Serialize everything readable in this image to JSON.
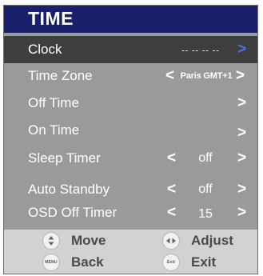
{
  "title": "TIME",
  "rows": [
    {
      "label": "Clock",
      "value": "-- --   -- --",
      "arrow_right": ">"
    },
    {
      "label": "Time Zone",
      "arrow_left": "<",
      "value": "Paris GMT+1",
      "arrow_right": ">"
    },
    {
      "label": "Off Time",
      "arrow_right": ">"
    },
    {
      "label": "On Time",
      "arrow_right": ">"
    },
    {
      "label": "Sleep Timer",
      "arrow_left": "<",
      "value": "off",
      "arrow_right": ">"
    },
    {
      "label": "Auto Standby",
      "arrow_left": "<",
      "value": "off",
      "arrow_right": ">"
    },
    {
      "label": "OSD Off Timer",
      "arrow_left": "<",
      "value": "15",
      "arrow_right": ">"
    }
  ],
  "footer": {
    "move": {
      "icon": "up-down-icon",
      "label": "Move"
    },
    "adjust": {
      "icon": "left-right-icon",
      "label": "Adjust"
    },
    "back": {
      "icon": "menu-button-icon",
      "icon_text": "MENU",
      "label": "Back"
    },
    "exit": {
      "icon": "exit-button-icon",
      "icon_text": "Exit",
      "label": "Exit"
    }
  },
  "colors": {
    "title_bar": "#191f68",
    "panel": "#9a9a9a",
    "selected_row": "#3e3e3e",
    "footer": "#d2d2d2",
    "accent_arrow": "#4f6df0"
  }
}
